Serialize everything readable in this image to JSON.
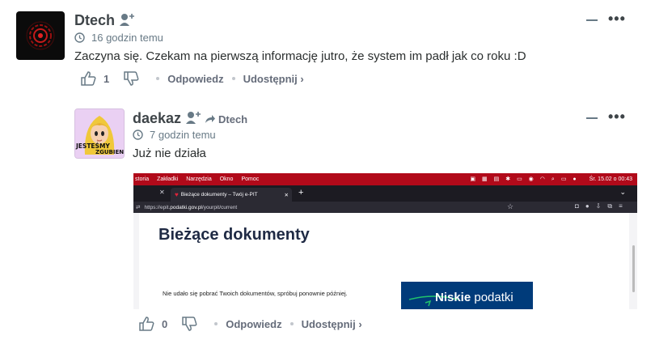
{
  "comment1": {
    "author": "Dtech",
    "time": "16 godzin temu",
    "text": "Zaczyna się. Czekam na pierwszą informację jutro, że system im padł jak co roku :D",
    "likes": "1",
    "reply_label": "Odpowiedz",
    "share_label": "Udostępnij ›"
  },
  "comment2": {
    "author": "daekaz",
    "reply_to": "Dtech",
    "time": "7 godzin temu",
    "text": "Już nie działa",
    "likes": "0",
    "reply_label": "Odpowiedz",
    "share_label": "Udostępnij ›",
    "avatar_text_1": "JESTEŚMY",
    "avatar_text_2": "ZGUBIENI"
  },
  "screenshot": {
    "menu": [
      "storia",
      "Zakładki",
      "Narzędzia",
      "Okno",
      "Pomoc"
    ],
    "clock": "Śr. 15.02 o 00:43",
    "tab_title": "Bieżące dokumenty – Twój e-PIT",
    "url_prefix": "https://epit.",
    "url_domain": "podatki.gov.pl",
    "url_path": "/yourpit/current",
    "heading": "Bieżące dokumenty",
    "error": "Nie udało się pobrać Twoich dokumentów, spróbuj ponownie później.",
    "promo_bold": "Niskie",
    "promo_rest": " podatki"
  },
  "colors": {
    "accent": "#b10a1a",
    "text": "#2a2e2e",
    "muted": "#687a86",
    "promo_bg": "#003b7a"
  }
}
